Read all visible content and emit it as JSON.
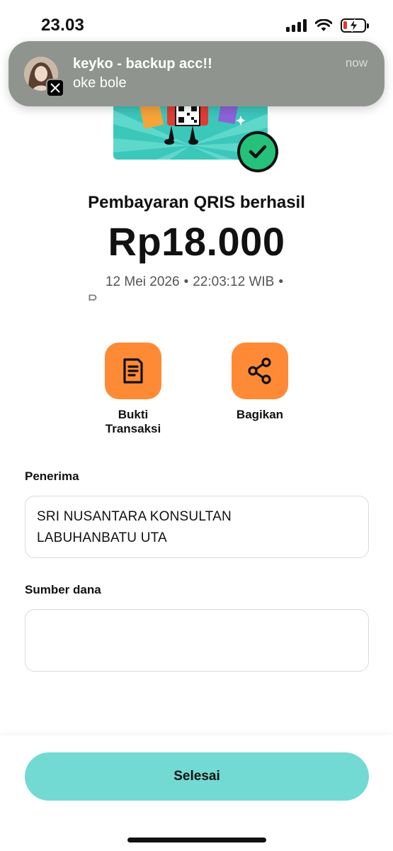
{
  "status_bar": {
    "time": "23.03",
    "icons": [
      "signal-icon",
      "wifi-icon",
      "battery-charging-icon"
    ]
  },
  "notification": {
    "app_icon": "x-logo-icon",
    "title": "keyko - backup acc!!",
    "body": "oke bole",
    "time": "now"
  },
  "result": {
    "title": "Pembayaran QRIS berhasil",
    "amount": "Rp18.000",
    "date": "12 Mei 2026",
    "time": "22:03:12 WIB",
    "separator": "•",
    "cut_line": "R"
  },
  "actions": [
    {
      "label": "Bukti Transaksi",
      "icon": "receipt-icon"
    },
    {
      "label": "Bagikan",
      "icon": "share-icon"
    }
  ],
  "recipient": {
    "label": "Penerima",
    "value_line1": "SRI NUSANTARA KONSULTAN",
    "value_line2": "LABUHANBATU UTA"
  },
  "source_of_funds": {
    "label": "Sumber dana",
    "value": ""
  },
  "footer": {
    "done_label": "Selesai"
  },
  "colors": {
    "accent_orange": "#ff8a35",
    "button_teal": "#72dad2",
    "success_green": "#25c17a",
    "banner_teal": "#3cc7bb"
  }
}
